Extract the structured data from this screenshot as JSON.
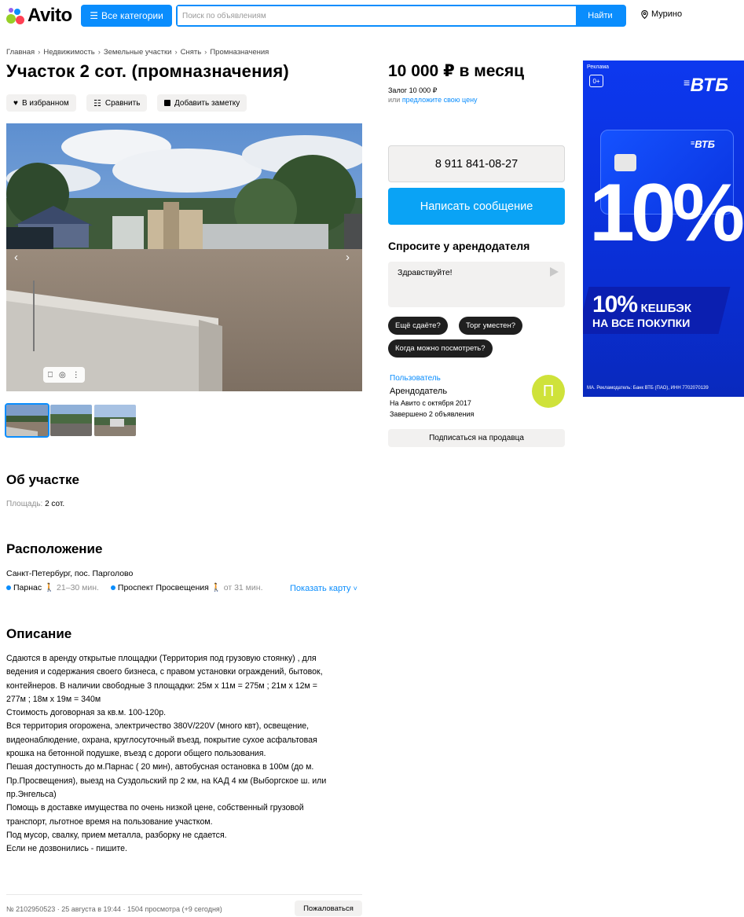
{
  "header": {
    "logo": "Avito",
    "categories_label": "Все категории",
    "search_placeholder": "Поиск по объявлениям",
    "search_button": "Найти",
    "location": "Мурино"
  },
  "breadcrumb": [
    "Главная",
    "Недвижимость",
    "Земельные участки",
    "Снять",
    "Промназначения"
  ],
  "listing": {
    "title": "Участок 2 сот. (промназначения)",
    "actions": {
      "favorite": "В избранном",
      "compare": "Сравнить",
      "note": "Добавить заметку"
    },
    "thumbnails_count": 3
  },
  "about": {
    "heading": "Об участке",
    "area_label": "Площадь:",
    "area_value": "2 сот."
  },
  "location_section": {
    "heading": "Расположение",
    "address": "Санкт-Петербург, пос. Парголово",
    "metro": [
      {
        "name": "Парнас",
        "time": "21–30 мин."
      },
      {
        "name": "Проспект Просвещения",
        "time": "от 31 мин."
      }
    ],
    "show_map": "Показать карту"
  },
  "description": {
    "heading": "Описание",
    "lines": [
      "Сдаются в аренду открытые площадки (Территория под грузовую стоянку) , для",
      "ведения и содержания своего бизнеса, с правом установки ограждений, бытовок,",
      "контейнеров. В наличии свободные 3 площадки: 25м х 11м = 275м ; 21м х 12м =",
      "277м ; 18м х 19м = 340м",
      "Стоимость договорная за кв.м. 100-120р.",
      "Вся территория огорожена, электричество 380V/220V (много квт), освещение,",
      "видеонаблюдение, охрана, круглосуточный въезд, покрытие сухое асфальтовая",
      "крошка на бетонной подушке, въезд с дороги общего пользования.",
      "Пешая доступность до м.Парнас ( 20 мин), автобусная остановка в 100м (до м.",
      "Пр.Просвещения), выезд на Суздольский пр 2 км, на КАД 4 км (Выборгское ш. или",
      "пр.Энгельса)",
      "Помощь в доставке имущества по очень низкой цене, собственный грузовой",
      "транспорт, льготное время на пользование участком.",
      "Под мусор, свалку, прием металла, разборку не сдается.",
      "Если не дозвонились - пишите."
    ]
  },
  "footer": {
    "meta": "№ 2102950523 · 25 августа в 19:44 · 1504 просмотра (+9 сегодня)",
    "report": "Пожаловаться"
  },
  "sidebar": {
    "price": "10 000 ₽ в месяц",
    "deposit": "Залог 10 000 ₽",
    "offer_prefix": "или ",
    "offer_link": "предложите свою цену",
    "phone": "8 911 841-08-27",
    "message_button": "Написать сообщение",
    "ask_title": "Спросите у арендодателя",
    "ask_value": "Здравствуйте!",
    "chips": [
      "Ещё сдаёте?",
      "Торг уместен?",
      "Когда можно посмотреть?"
    ],
    "seller": {
      "name": "Пользователь",
      "role": "Арендодатель",
      "since": "На Авито с октября 2017",
      "completed": "Завершено 2 объявления",
      "avatar_letter": "П"
    },
    "subscribe": "Подписаться на продавца"
  },
  "ad": {
    "label": "Реклама",
    "age": "0+",
    "brand": "ВТБ",
    "card_brand": "ВТБ",
    "big_text": "10%",
    "cashback_pct": "10%",
    "cashback_word": "КЕШБЭК",
    "cashback_line2": "НА ВСЕ ПОКУПКИ",
    "footer_text": "МА. Рекламодатель: Банк ВТБ (ПАО), ИНН 7702070139"
  },
  "colors": {
    "accent": "#0a8dfd",
    "message_button": "#0aa3f5",
    "avatar": "#cfe23a",
    "ad_bg": "#0d38ef"
  }
}
